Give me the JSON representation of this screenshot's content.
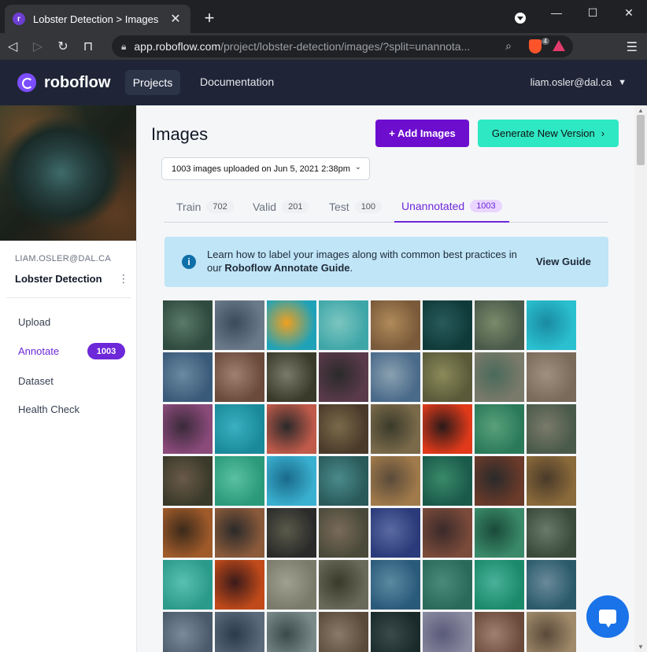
{
  "browser": {
    "tab_title": "Lobster Detection > Images",
    "tab_close": "✕",
    "new_tab": "+",
    "url_host": "app.roboflow.com",
    "url_path": "/project/lobster-detection/images/?split=unannota...",
    "brave_count": "4",
    "controls": {
      "minimize": "—",
      "maximize": "☐",
      "close": "✕"
    }
  },
  "header": {
    "logo_text": "roboflow",
    "nav_projects": "Projects",
    "nav_docs": "Documentation",
    "user_email": "liam.osler@dal.ca"
  },
  "sidebar": {
    "owner": "LIAM.OSLER@DAL.CA",
    "project_name": "Lobster Detection",
    "items": [
      {
        "label": "Upload"
      },
      {
        "label": "Annotate",
        "badge": "1003"
      },
      {
        "label": "Dataset"
      },
      {
        "label": "Health Check"
      }
    ]
  },
  "main": {
    "title": "Images",
    "add_images": "+ Add Images",
    "generate_version": "Generate New Version",
    "batch_select": "1003 images uploaded on Jun 5, 2021 2:38pm",
    "tabs": [
      {
        "label": "Train",
        "count": "702"
      },
      {
        "label": "Valid",
        "count": "201"
      },
      {
        "label": "Test",
        "count": "100"
      },
      {
        "label": "Unannotated",
        "count": "1003"
      }
    ],
    "info": {
      "text_pre": "Learn how to label your images along with common best practices in our",
      "text_link": "Roboflow Annotate Guide",
      "text_post": ".",
      "action": "View Guide"
    }
  },
  "colors": {
    "accent": "#6d28d9",
    "add_button": "#6d0ecf",
    "generate_button": "#2ee8c4",
    "info_bg": "#bfe5f7",
    "header_bg": "#1f2537"
  },
  "thumbnails": [
    [
      "#2f4a3f",
      "#5a7a6a"
    ],
    [
      "#6b7a8a",
      "#3a4a5a"
    ],
    [
      "#1fa2b8",
      "#f0a020"
    ],
    [
      "#3fa6a8",
      "#7cc6c0"
    ],
    [
      "#7a5a3a",
      "#b08a5a"
    ],
    [
      "#0f3a3a",
      "#2a5a5a"
    ],
    [
      "#4a5a4a",
      "#7a8a6a"
    ],
    [
      "#2ac0d0",
      "#1a8aa0"
    ],
    [
      "#3a5a7a",
      "#6a8aa0"
    ],
    [
      "#6a4a3a",
      "#a08070"
    ],
    [
      "#3a3a2a",
      "#7a7a6a"
    ],
    [
      "#5a3a4a",
      "#2a2a2a"
    ],
    [
      "#4a6a8a",
      "#8aa0b0"
    ],
    [
      "#5a5a3a",
      "#8a8a5a"
    ],
    [
      "#7a7a6a",
      "#4a6a5a"
    ],
    [
      "#7a6a5a",
      "#a09080"
    ],
    [
      "#8a4a7a",
      "#3a2a3a"
    ],
    [
      "#1a8a9a",
      "#3ab0c0"
    ],
    [
      "#c05a4a",
      "#2a2a2a"
    ],
    [
      "#4a3a2a",
      "#7a6a4a"
    ],
    [
      "#7a6a4a",
      "#3a3a2a"
    ],
    [
      "#e03a1a",
      "#2a1a1a"
    ],
    [
      "#2a7a5a",
      "#5aa07a"
    ],
    [
      "#4a5a4a",
      "#7a7a6a"
    ],
    [
      "#3a3a2a",
      "#6a5a4a"
    ],
    [
      "#2a9a7a",
      "#5ac0a0"
    ],
    [
      "#3ab0d0",
      "#1a6a8a"
    ],
    [
      "#2a5a5a",
      "#4a8a8a"
    ],
    [
      "#a07a4a",
      "#5a4a3a"
    ],
    [
      "#1a5a4a",
      "#3a8a6a"
    ],
    [
      "#6a3a2a",
      "#2a2a2a"
    ],
    [
      "#8a6a3a",
      "#4a3a2a"
    ],
    [
      "#a05a2a",
      "#3a2a1a"
    ],
    [
      "#8a5a3a",
      "#2a2a2a"
    ],
    [
      "#2a2a2a",
      "#5a5a4a"
    ],
    [
      "#4a4a3a",
      "#7a6a5a"
    ],
    [
      "#2a3a7a",
      "#5a6aa0"
    ],
    [
      "#7a4a3a",
      "#3a2a2a"
    ],
    [
      "#3a8a6a",
      "#1a4a3a"
    ],
    [
      "#3a4a3a",
      "#6a7a6a"
    ],
    [
      "#2a9a8a",
      "#5ac0b0"
    ],
    [
      "#c04a1a",
      "#3a1a1a"
    ],
    [
      "#7a7a6a",
      "#a0a090"
    ],
    [
      "#6a6a5a",
      "#3a3a2a"
    ],
    [
      "#2a5a7a",
      "#5a8aa0"
    ],
    [
      "#2a6a5a",
      "#4a8a7a"
    ],
    [
      "#1a8a6a",
      "#4ab09a"
    ],
    [
      "#2a5a6a",
      "#6a8a9a"
    ],
    [
      "#4a5a6a",
      "#7a8a9a"
    ],
    [
      "#5a6a7a",
      "#2a3a4a"
    ],
    [
      "#7a8a8a",
      "#3a4a4a"
    ],
    [
      "#5a4a3a",
      "#8a7a6a"
    ],
    [
      "#1a2a2a",
      "#3a4a4a"
    ],
    [
      "#8a8aa0",
      "#5a5a7a"
    ],
    [
      "#6a4a3a",
      "#a08070"
    ],
    [
      "#a08a6a",
      "#5a4a3a"
    ]
  ]
}
